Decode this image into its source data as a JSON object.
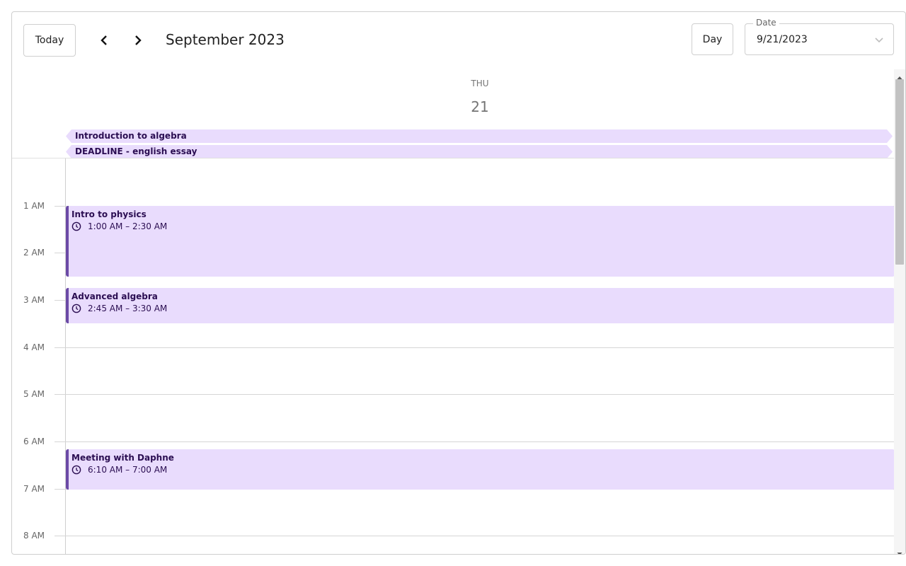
{
  "toolbar": {
    "today_label": "Today",
    "period_title": "September 2023",
    "view_label": "Day",
    "date_field": {
      "legend": "Date",
      "value": "9/21/2023"
    }
  },
  "day_header": {
    "weekday": "THU",
    "day_number": "21"
  },
  "all_day_events": [
    {
      "title": "Introduction to algebra"
    },
    {
      "title": "DEADLINE - english essay"
    }
  ],
  "hour_labels": [
    "1 AM",
    "2 AM",
    "3 AM",
    "4 AM",
    "5 AM",
    "6 AM",
    "7 AM",
    "8 AM"
  ],
  "events": [
    {
      "title": "Intro to physics",
      "time": "1:00 AM – 2:30 AM"
    },
    {
      "title": "Advanced algebra",
      "time": "2:45 AM – 3:30 AM"
    },
    {
      "title": "Meeting with Daphne",
      "time": "6:10 AM – 7:00 AM"
    }
  ],
  "colors": {
    "event_bg": "#e9dcfd",
    "event_accent": "#6b4aa6",
    "event_text": "#2b0e52"
  }
}
